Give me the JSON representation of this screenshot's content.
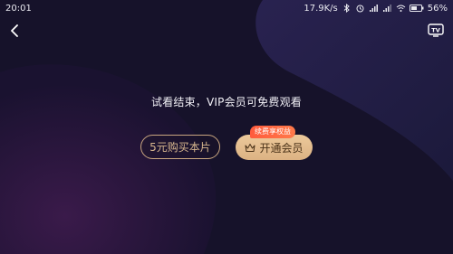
{
  "status_bar": {
    "time": "20:01",
    "network_speed": "17.9K/s",
    "battery": "56%",
    "icons": [
      "bluetooth-icon",
      "alarm-icon",
      "signal-icon",
      "signal-icon",
      "wifi-icon",
      "battery-icon"
    ]
  },
  "player": {
    "back_icon": "chevron-left-icon",
    "tv_icon": "tv-cast-icon",
    "tv_label": "TV",
    "message": "试看结束，VIP会员可免费观看",
    "buy_button_label": "5元购买本片",
    "vip_button_label": "开通会员",
    "vip_button_icon": "crown-icon",
    "badge_label": "续费享权益"
  },
  "colors": {
    "background": "#15112a",
    "accent_gold": "#dcb283",
    "gold_outline": "#c9a680",
    "badge_red": "#ff5a3c"
  }
}
